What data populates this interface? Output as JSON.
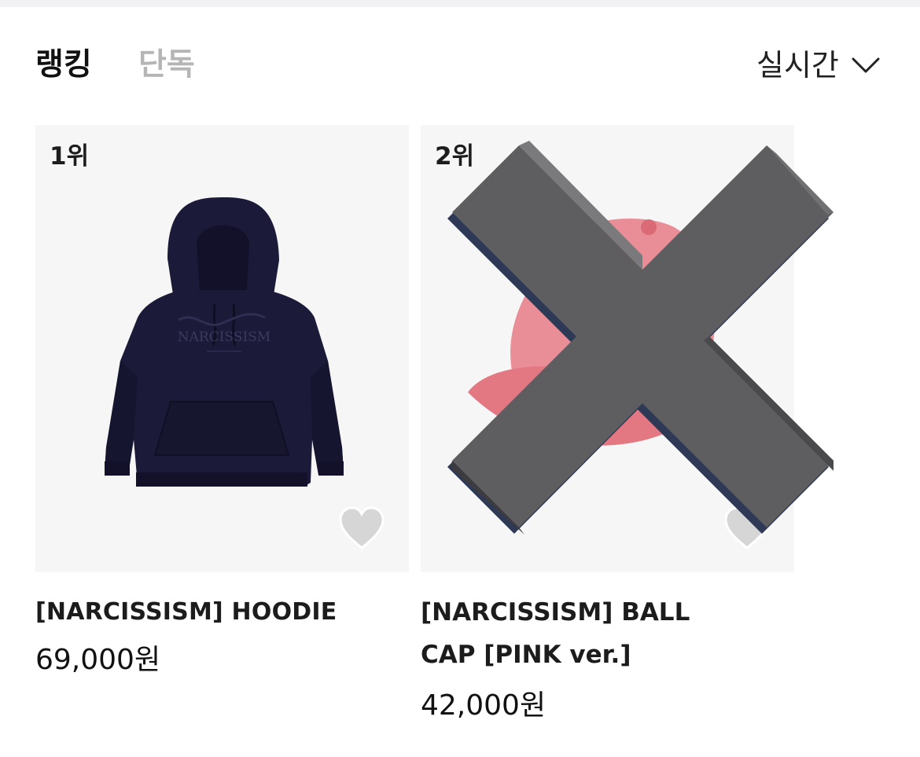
{
  "tabs": {
    "ranking": "랭킹",
    "exclusive": "단독"
  },
  "sort": {
    "label": "실시간",
    "icon": "chevron-down-icon"
  },
  "products": [
    {
      "rank": "1위",
      "name": "[NARCISSISM] HOODIE",
      "price": "69,000원",
      "image_icon": "hoodie-image",
      "image_text": "NARCISSISM",
      "wishlist_icon": "heart-icon"
    },
    {
      "rank": "2위",
      "name": "[NARCISSISM] BALL CAP [PINK ver.]",
      "price": "42,000원",
      "image_icon": "ball-cap-image",
      "wishlist_icon": "heart-icon",
      "overlay_icon": "x-mark-icon"
    }
  ],
  "colors": {
    "active_tab": "#111111",
    "inactive_tab": "#b5b5b5",
    "card_background": "#f6f6f7",
    "hoodie": "#1b1a38",
    "cap": "#e07a85",
    "x_mark": "#5e5e60"
  }
}
